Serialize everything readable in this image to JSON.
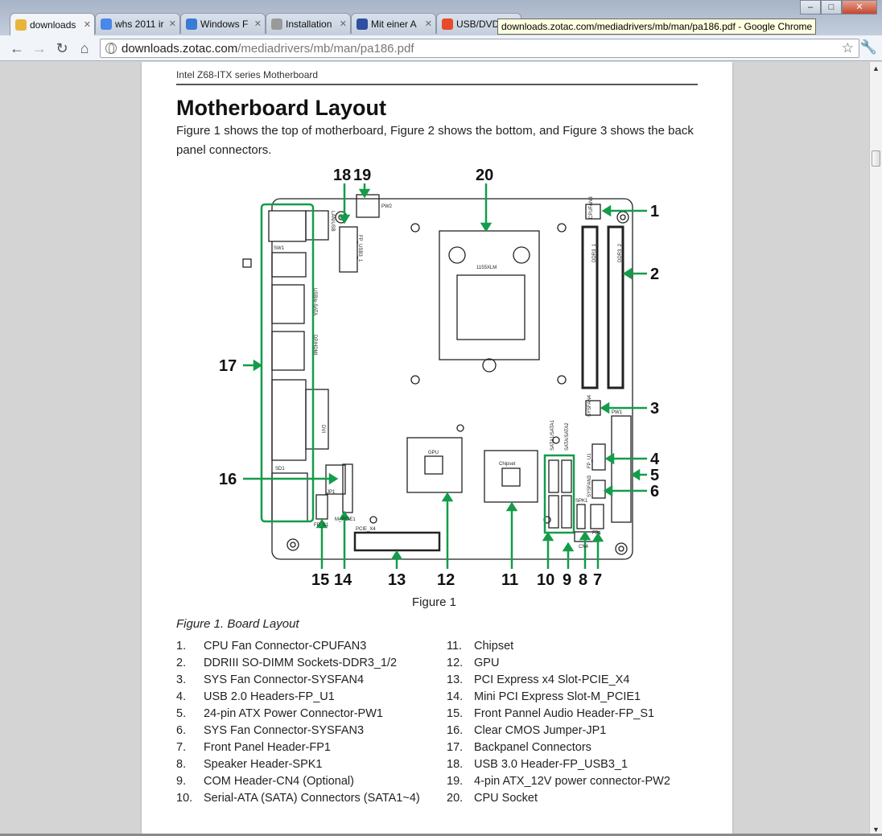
{
  "browser": {
    "tabs": [
      {
        "title": "downloads",
        "favicon_color": "#e8b53a",
        "active": true
      },
      {
        "title": "whs 2011 ir",
        "favicon_color": "#4a87e8",
        "active": false
      },
      {
        "title": "Windows F",
        "favicon_color": "#3a7bd5",
        "active": false
      },
      {
        "title": "Installation",
        "favicon_color": "#9a9a9a",
        "active": false
      },
      {
        "title": "Mit einer A",
        "favicon_color": "#2f4fa0",
        "active": false
      },
      {
        "title": "USB/DVD",
        "favicon_color": "#e84a2a",
        "active": false
      }
    ],
    "tooltip": "downloads.zotac.com/mediadrivers/mb/man/pa186.pdf - Google Chrome",
    "url_host": "downloads.zotac.com",
    "url_path": "/mediadrivers/mb/man/pa186.pdf",
    "icons": {
      "back": "back-arrow-icon",
      "forward": "forward-arrow-icon",
      "reload": "reload-icon",
      "home": "home-icon",
      "star": "bookmark-star-icon",
      "wrench": "wrench-icon"
    }
  },
  "document": {
    "running_head": "Intel Z68-ITX series Motherboard",
    "title": "Motherboard Layout",
    "intro": "Figure 1 shows the top of motherboard, Figure 2 shows the bottom, and Figure 3 shows the back panel connectors.",
    "figure_caption": "Figure 1",
    "figure_title": "Figure 1. Board Layout",
    "callout_color": "#149c4a",
    "diagram_labels": {
      "n1": "1",
      "n2": "2",
      "n3": "3",
      "n4": "4",
      "n5": "5",
      "n6": "6",
      "n7": "7",
      "n8": "8",
      "n9": "9",
      "n10": "10",
      "n11": "11",
      "n12": "12",
      "n13": "13",
      "n14": "14",
      "n15": "15",
      "n16": "16",
      "n17": "17",
      "n18": "18",
      "n19": "19",
      "n20": "20",
      "cpufan": "CPUFAN3",
      "ddr1": "DDR3_1",
      "ddr2": "DDR3_2",
      "sysfan4": "SYSFAN4",
      "pw1": "PW1",
      "fpu1": "FP_U1",
      "sysfan3": "SYSFAN3",
      "spk": "SPK1",
      "fp1": "FP1",
      "cn4": "CN4",
      "sata1": "SATA1/SATA1",
      "sata2": "SATA/SATA2",
      "chipset": "Chipset",
      "gpu": "GPU",
      "pcie": "PCIE_X4",
      "mpcie": "M_PCIE1",
      "fps": "FP_S1",
      "jp1": "JP1",
      "sd": "SD1",
      "dvi": "DVI",
      "dp": "DP/HDMI",
      "usb_esata": "USB/e-SATA",
      "sw": "SW1",
      "lan": "LAN/USB",
      "fpusb3": "FP_USB3_1",
      "pw2": "PW2",
      "socket": "1155XLM"
    },
    "legend_left": [
      {
        "n": "1.",
        "t": "CPU Fan Connector-CPUFAN3"
      },
      {
        "n": "2.",
        "t": "DDRIII SO-DIMM Sockets-DDR3_1/2"
      },
      {
        "n": "3.",
        "t": "SYS Fan Connector-SYSFAN4"
      },
      {
        "n": "4.",
        "t": "USB 2.0 Headers-FP_U1"
      },
      {
        "n": "5.",
        "t": "24-pin ATX Power Connector-PW1"
      },
      {
        "n": "6.",
        "t": "SYS Fan Connector-SYSFAN3"
      },
      {
        "n": "7.",
        "t": "Front Panel Header-FP1"
      },
      {
        "n": "8.",
        "t": "Speaker Header-SPK1"
      },
      {
        "n": "9.",
        "t": "COM Header-CN4 (Optional)"
      },
      {
        "n": "10.",
        "t": "Serial-ATA (SATA) Connectors (SATA1~4)"
      }
    ],
    "legend_right": [
      {
        "n": "11.",
        "t": "Chipset"
      },
      {
        "n": "12.",
        "t": "GPU"
      },
      {
        "n": "13.",
        "t": "PCI Express x4 Slot-PCIE_X4"
      },
      {
        "n": "14.",
        "t": "Mini PCI Express Slot-M_PCIE1"
      },
      {
        "n": "15.",
        "t": "Front Pannel Audio Header-FP_S1"
      },
      {
        "n": "16.",
        "t": "Clear CMOS Jumper-JP1"
      },
      {
        "n": "17.",
        "t": "Backpanel Connectors"
      },
      {
        "n": "18.",
        "t": "USB 3.0 Header-FP_USB3_1"
      },
      {
        "n": "19.",
        "t": "4-pin ATX_12V power connector-PW2"
      },
      {
        "n": "20.",
        "t": "CPU Socket"
      }
    ]
  }
}
